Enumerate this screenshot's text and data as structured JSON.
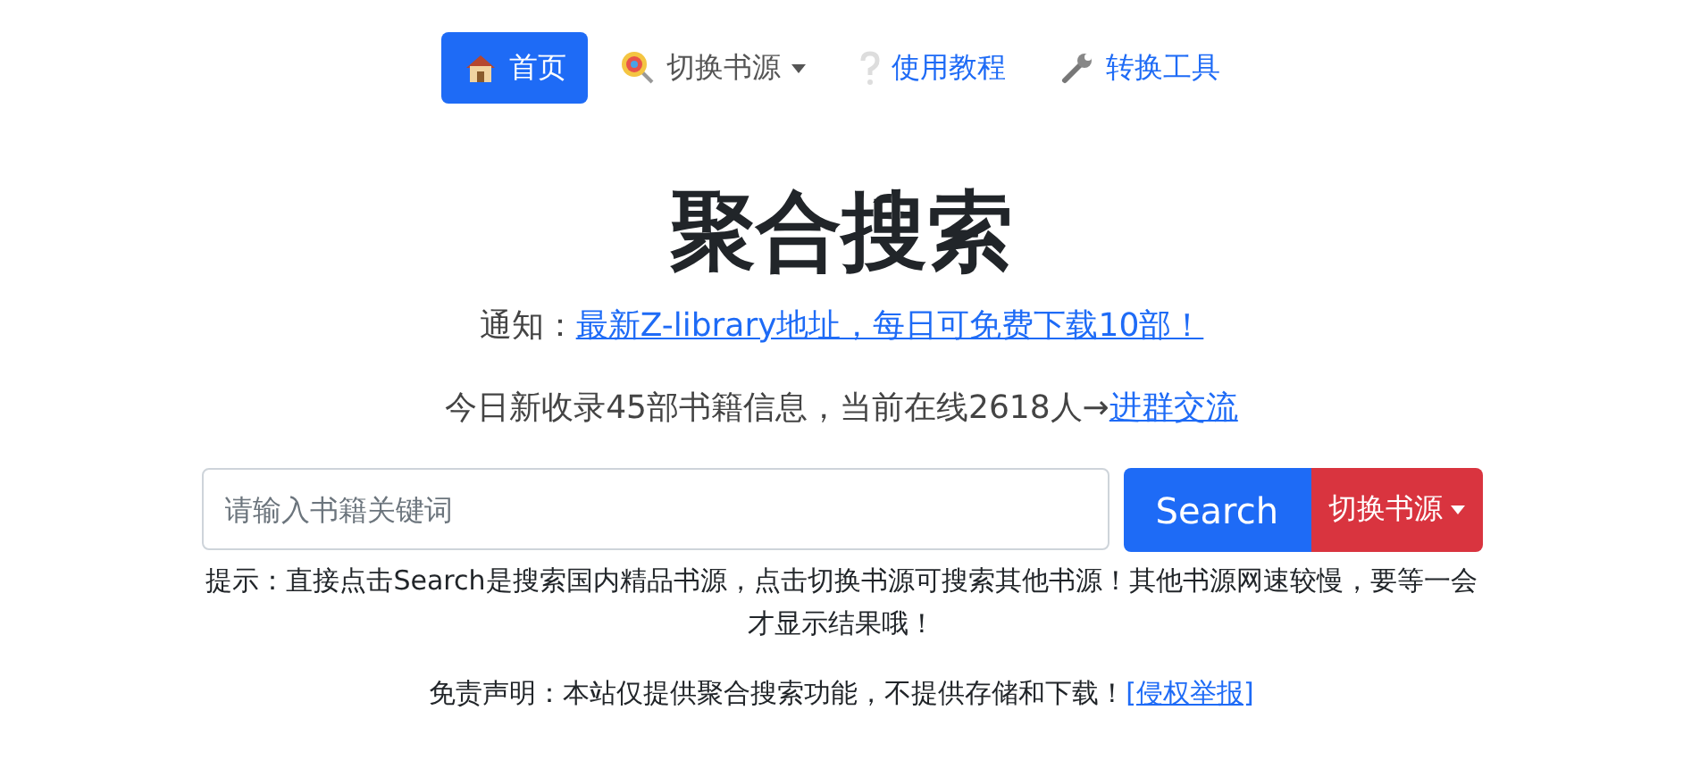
{
  "nav": [
    {
      "label": "首页",
      "kind": "link",
      "selected": true
    },
    {
      "label": "切换书源",
      "kind": "dropdown",
      "selected": false
    },
    {
      "label": "使用教程",
      "kind": "link",
      "selected": false
    },
    {
      "label": "转换工具",
      "kind": "link",
      "selected": false
    }
  ],
  "title": "聚合搜索",
  "notice": {
    "label": "通知：",
    "link": "最新Z-library地址，每日可免费下载10部！"
  },
  "stats": {
    "text": "今日新收录45部书籍信息，当前在线2618人→",
    "link": "进群交流"
  },
  "search": {
    "placeholder": "请输入书籍关键词",
    "button": "Search",
    "source_button": "切换书源"
  },
  "hint": "提示：直接点击Search是搜索国内精品书源，点击切换书源可搜索其他书源！其他书源网速较慢，要等一会才显示结果哦！",
  "disclaimer": {
    "text": "免责声明：本站仅提供聚合搜索功能，不提供存储和下载！",
    "link": "[侵权举报]"
  }
}
